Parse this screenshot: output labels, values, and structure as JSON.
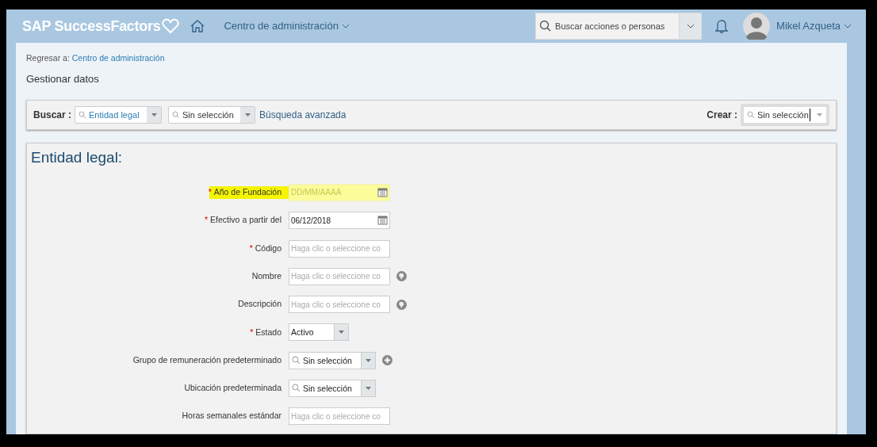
{
  "header": {
    "brand": "SAP SuccessFactors",
    "module_menu": "Centro de administración",
    "search": {
      "placeholder": "Buscar acciones o personas"
    },
    "user_name": "Mikel Azqueta"
  },
  "breadcrumb": {
    "prefix": "Regresar a:",
    "link": "Centro de administración"
  },
  "page_title": "Gestionar datos",
  "search_bar": {
    "label": "Buscar :",
    "type_select": "Entidad legal",
    "item_select": "Sin selección",
    "advanced_link": "Búsqueda avanzada",
    "create_label": "Crear :",
    "create_select": "Sin selección"
  },
  "form": {
    "title": "Entidad legal:",
    "fields": [
      {
        "label": "Año de Fundación",
        "required_mark": "*",
        "highlighted": true,
        "kind": "date",
        "placeholder": "DD/MM/AAAA"
      },
      {
        "label": "Efectivo a partir del",
        "required_mark": "*",
        "highlighted": false,
        "kind": "date",
        "value": "06/12/2018"
      },
      {
        "label": "Código",
        "required_mark": "*",
        "highlighted": false,
        "kind": "text",
        "placeholder": "Haga clic o seleccione co"
      },
      {
        "label": "Nombre",
        "highlighted": false,
        "kind": "text",
        "placeholder": "Haga clic o seleccione co",
        "extra": {
          "kind": "globe"
        }
      },
      {
        "label": "Descripción",
        "highlighted": false,
        "kind": "text",
        "placeholder": "Haga clic o seleccione co",
        "extra": {
          "kind": "globe"
        }
      },
      {
        "label": "Estado",
        "required_mark": "*",
        "highlighted": false,
        "kind": "select",
        "value": "Activo"
      },
      {
        "label": "Grupo de remuneración predeterminado",
        "highlighted": false,
        "kind": "lookup",
        "value": "Sin selección",
        "extra": {
          "kind": "plus"
        }
      },
      {
        "label": "Ubicación predeterminada",
        "highlighted": false,
        "kind": "lookup",
        "value": "Sin selección"
      },
      {
        "label": "Horas semanales estándar",
        "highlighted": false,
        "kind": "text",
        "placeholder": "Haga clic o seleccione co"
      }
    ]
  }
}
